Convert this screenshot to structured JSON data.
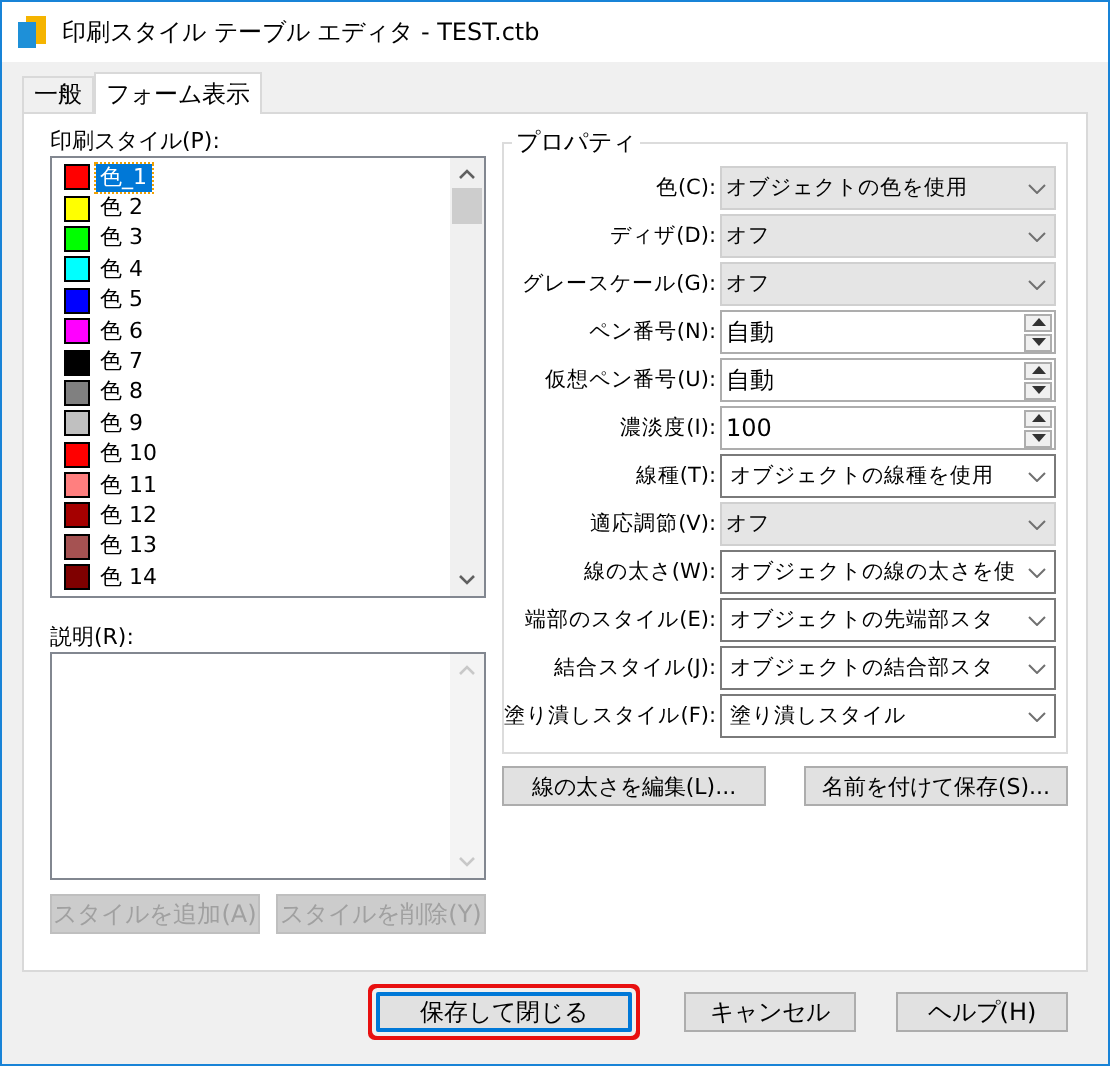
{
  "window": {
    "title": "印刷スタイル テーブル エディタ - TEST.ctb"
  },
  "tabs": [
    {
      "label": "一般",
      "selected": false
    },
    {
      "label": "フォーム表示",
      "selected": true
    }
  ],
  "styles_list": {
    "label": "印刷スタイル(P):",
    "items": [
      {
        "label": "色_1",
        "color": "#ff0000",
        "selected": true
      },
      {
        "label": "色 2",
        "color": "#ffff00",
        "selected": false
      },
      {
        "label": "色 3",
        "color": "#00ff00",
        "selected": false
      },
      {
        "label": "色 4",
        "color": "#00ffff",
        "selected": false
      },
      {
        "label": "色 5",
        "color": "#0000ff",
        "selected": false
      },
      {
        "label": "色 6",
        "color": "#ff00ff",
        "selected": false
      },
      {
        "label": "色 7",
        "color": "#000000",
        "selected": false
      },
      {
        "label": "色 8",
        "color": "#808080",
        "selected": false
      },
      {
        "label": "色 9",
        "color": "#c0c0c0",
        "selected": false
      },
      {
        "label": "色 10",
        "color": "#ff0000",
        "selected": false
      },
      {
        "label": "色 11",
        "color": "#ff7f7f",
        "selected": false
      },
      {
        "label": "色 12",
        "color": "#a50000",
        "selected": false
      },
      {
        "label": "色 13",
        "color": "#a55252",
        "selected": false
      },
      {
        "label": "色 14",
        "color": "#7f0000",
        "selected": false
      }
    ]
  },
  "description": {
    "label": "説明(R):"
  },
  "left_buttons": [
    {
      "label": "スタイルを追加(A)",
      "disabled": true
    },
    {
      "label": "スタイルを削除(Y)",
      "disabled": true
    }
  ],
  "properties": {
    "title": "プロパティ",
    "rows": [
      {
        "label": "色(C):",
        "kind": "dropdown",
        "value": "オブジェクトの色を使用"
      },
      {
        "label": "ディザ(D):",
        "kind": "dropdown",
        "value": "オフ"
      },
      {
        "label": "グレースケール(G):",
        "kind": "dropdown",
        "value": "オフ"
      },
      {
        "label": "ペン番号(N):",
        "kind": "spin",
        "value": "自動"
      },
      {
        "label": "仮想ペン番号(U):",
        "kind": "spin",
        "value": "自動"
      },
      {
        "label": "濃淡度(I):",
        "kind": "spin",
        "value": "100"
      },
      {
        "label": "線種(T):",
        "kind": "combo",
        "value": "オブジェクトの線種を使用"
      },
      {
        "label": "適応調節(V):",
        "kind": "dropdown",
        "value": "オフ"
      },
      {
        "label": "線の太さ(W):",
        "kind": "combo",
        "value": "オブジェクトの線の太さを使"
      },
      {
        "label": "端部のスタイル(E):",
        "kind": "combo",
        "value": "オブジェクトの先端部スタ"
      },
      {
        "label": "結合スタイル(J):",
        "kind": "combo",
        "value": "オブジェクトの結合部スタ"
      },
      {
        "label": "塗り潰しスタイル(F):",
        "kind": "combo",
        "value": "塗り潰しスタイル"
      }
    ]
  },
  "right_buttons": [
    {
      "label": "線の太さを編集(L)..."
    },
    {
      "label": "名前を付けて保存(S)..."
    }
  ],
  "footer_buttons": [
    {
      "label": "保存して閉じる",
      "highlighted": true
    },
    {
      "label": "キャンセル",
      "highlighted": false
    },
    {
      "label": "ヘルプ(H)",
      "highlighted": false
    }
  ]
}
